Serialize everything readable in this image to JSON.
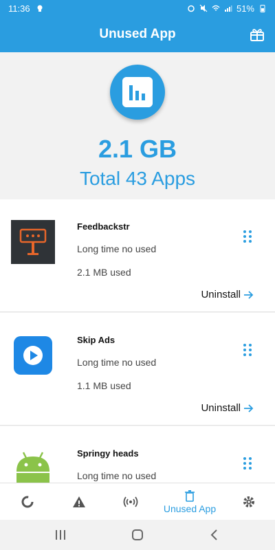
{
  "status_bar": {
    "time": "11:36",
    "battery": "51%"
  },
  "app_bar": {
    "title": "Unused App",
    "gift_icon": "gift-icon"
  },
  "summary": {
    "size": "2.1 GB",
    "total": "Total 43 Apps",
    "icon": "bar-chart-icon"
  },
  "apps": [
    {
      "name": "Feedbackstr",
      "status": "Long time no used",
      "size": "2.1 MB used",
      "action": "Uninstall",
      "icon": "feedbackstr-icon"
    },
    {
      "name": "Skip Ads",
      "status": "Long time no used",
      "size": "1.1 MB used",
      "action": "Uninstall",
      "icon": "skip-ads-icon"
    },
    {
      "name": "Springy heads",
      "status": "Long time no used",
      "size": "",
      "action": "",
      "icon": "android-icon"
    }
  ],
  "bottom_nav": {
    "items": [
      {
        "icon": "loading-icon",
        "label": ""
      },
      {
        "icon": "warning-icon",
        "label": ""
      },
      {
        "icon": "broadcast-icon",
        "label": ""
      },
      {
        "icon": "trash-icon",
        "label": "Unused App"
      },
      {
        "icon": "gear-icon",
        "label": ""
      }
    ],
    "active_color": "#2a9de0"
  },
  "colors": {
    "primary": "#2a9de0"
  }
}
